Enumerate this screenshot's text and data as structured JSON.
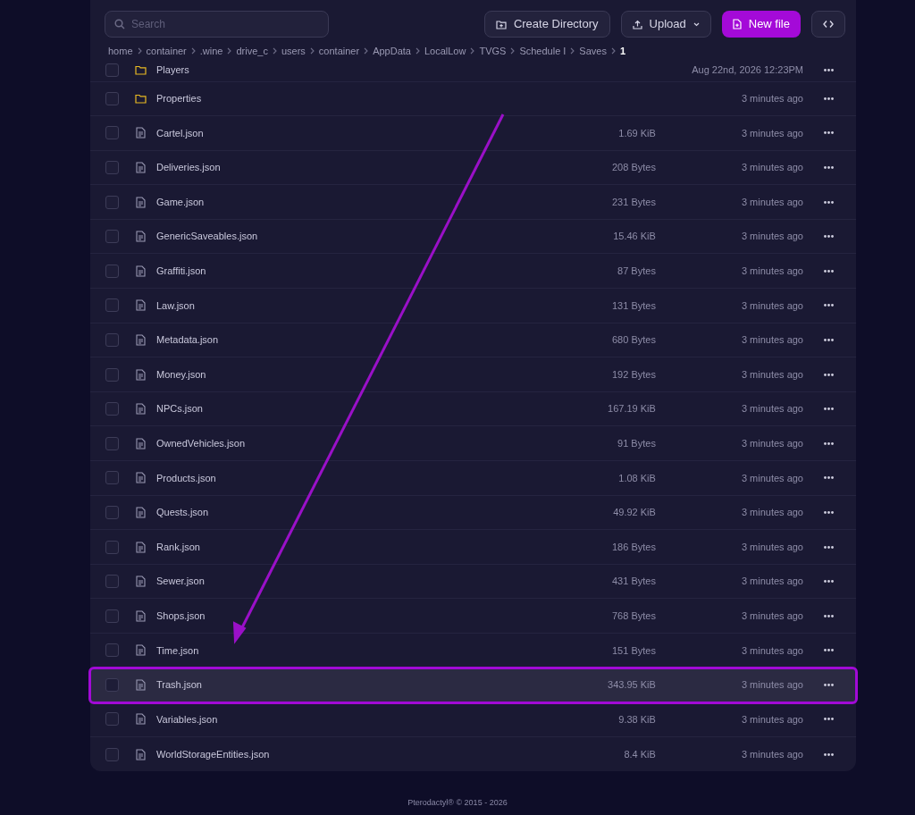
{
  "toolbar": {
    "search": {
      "placeholder": "Search"
    },
    "buttons": [
      {
        "kind": "create-directory",
        "label": "Create Directory"
      },
      {
        "kind": "upload",
        "label": "Upload"
      },
      {
        "kind": "new-file",
        "label": "New file"
      },
      {
        "kind": "code"
      }
    ]
  },
  "breadcrumb": [
    "home",
    "container",
    ".wine",
    "drive_c",
    "users",
    "container",
    "AppData",
    "LocalLow",
    "TVGS",
    "Schedule I",
    "Saves",
    "1"
  ],
  "files": [
    {
      "kind": "folder",
      "name": "Players",
      "modified": "Aug 22nd, 2026 12:23PM",
      "checked": false,
      "highlighted": false
    },
    {
      "kind": "folder",
      "name": "Properties",
      "modified": "3 minutes ago",
      "checked": false,
      "highlighted": false
    },
    {
      "kind": "file",
      "name": "Cartel.json",
      "size": "1.69 KiB",
      "modified": "3 minutes ago",
      "checked": false,
      "highlighted": false
    },
    {
      "kind": "file",
      "name": "Deliveries.json",
      "size": "208 Bytes",
      "modified": "3 minutes ago",
      "checked": false,
      "highlighted": false
    },
    {
      "kind": "file",
      "name": "Game.json",
      "size": "231 Bytes",
      "modified": "3 minutes ago",
      "checked": false,
      "highlighted": false
    },
    {
      "kind": "file",
      "name": "GenericSaveables.json",
      "size": "15.46 KiB",
      "modified": "3 minutes ago",
      "checked": false,
      "highlighted": false
    },
    {
      "kind": "file",
      "name": "Graffiti.json",
      "size": "87 Bytes",
      "modified": "3 minutes ago",
      "checked": false,
      "highlighted": false
    },
    {
      "kind": "file",
      "name": "Law.json",
      "size": "131 Bytes",
      "modified": "3 minutes ago",
      "checked": false,
      "highlighted": false
    },
    {
      "kind": "file",
      "name": "Metadata.json",
      "size": "680 Bytes",
      "modified": "3 minutes ago",
      "checked": false,
      "highlighted": false
    },
    {
      "kind": "file",
      "name": "Money.json",
      "size": "192 Bytes",
      "modified": "3 minutes ago",
      "checked": false,
      "highlighted": false
    },
    {
      "kind": "file",
      "name": "NPCs.json",
      "size": "167.19 KiB",
      "modified": "3 minutes ago",
      "checked": false,
      "highlighted": false
    },
    {
      "kind": "file",
      "name": "OwnedVehicles.json",
      "size": "91 Bytes",
      "modified": "3 minutes ago",
      "checked": false,
      "highlighted": false
    },
    {
      "kind": "file",
      "name": "Products.json",
      "size": "1.08 KiB",
      "modified": "3 minutes ago",
      "checked": false,
      "highlighted": false
    },
    {
      "kind": "file",
      "name": "Quests.json",
      "size": "49.92 KiB",
      "modified": "3 minutes ago",
      "checked": false,
      "highlighted": false
    },
    {
      "kind": "file",
      "name": "Rank.json",
      "size": "186 Bytes",
      "modified": "3 minutes ago",
      "checked": false,
      "highlighted": false
    },
    {
      "kind": "file",
      "name": "Sewer.json",
      "size": "431 Bytes",
      "modified": "3 minutes ago",
      "checked": false,
      "highlighted": false
    },
    {
      "kind": "file",
      "name": "Shops.json",
      "size": "768 Bytes",
      "modified": "3 minutes ago",
      "checked": false,
      "highlighted": false
    },
    {
      "kind": "file",
      "name": "Time.json",
      "size": "151 Bytes",
      "modified": "3 minutes ago",
      "checked": false,
      "highlighted": false
    },
    {
      "kind": "file",
      "name": "Trash.json",
      "size": "343.95 KiB",
      "modified": "3 minutes ago",
      "checked": false,
      "highlighted": true
    },
    {
      "kind": "file",
      "name": "Variables.json",
      "size": "9.38 KiB",
      "modified": "3 minutes ago",
      "checked": false,
      "highlighted": false
    },
    {
      "kind": "file",
      "name": "WorldStorageEntities.json",
      "size": "8.4 KiB",
      "modified": "3 minutes ago",
      "checked": false,
      "highlighted": false
    }
  ],
  "footer": "Pterodactyl® © 2015 - 2026"
}
